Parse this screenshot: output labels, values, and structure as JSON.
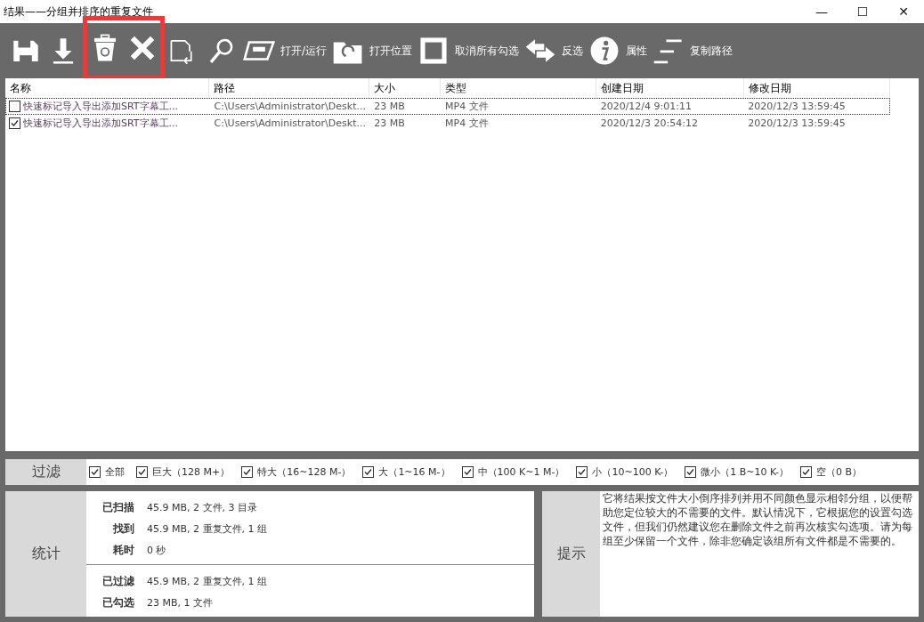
{
  "window": {
    "title": "结果——分组并排序的重复文件",
    "controls": [
      "—",
      "☐",
      "✕"
    ]
  },
  "toolbar": [
    {
      "highlighted": false,
      "items": [
        {
          "kind": "icon"
        },
        {
          "kind": "icon"
        }
      ]
    },
    {
      "highlighted": true,
      "items": [
        {
          "kind": "icon"
        },
        {
          "kind": "icon"
        }
      ]
    },
    {
      "highlighted": false,
      "items": [
        {
          "kind": "icon"
        },
        {
          "kind": "icon"
        },
        {
          "kind": "labeled",
          "label": "打开/运行"
        },
        {
          "kind": "labeled",
          "label": "打开位置"
        },
        {
          "kind": "labeled",
          "label": "取消所有勾选"
        },
        {
          "kind": "labeled",
          "label": "反选"
        },
        {
          "kind": "labeled",
          "label": "属性"
        },
        {
          "kind": "labeled",
          "label": "复制路径"
        }
      ]
    }
  ],
  "table": {
    "columns": [
      "名称",
      "路径",
      "大小",
      "类型",
      "创建日期",
      "修改日期"
    ],
    "rows": [
      {
        "checked": false,
        "focused": true,
        "cells": [
          "快速标记导入导出添加SRT字幕工...",
          "C:\\Users\\Administrator\\Deskt...",
          "23 MB",
          "MP4 文件",
          "2020/12/4 9:01:11",
          "2020/12/3 13:59:45"
        ]
      },
      {
        "checked": true,
        "focused": false,
        "cells": [
          "快速标记导入导出添加SRT字幕工...",
          "C:\\Users\\Administrator\\Deskt...",
          "23 MB",
          "MP4 文件",
          "2020/12/3 20:54:12",
          "2020/12/3 13:59:45"
        ]
      }
    ]
  },
  "filter": {
    "label": "过滤",
    "options": [
      {
        "label": "全部",
        "checked": true
      },
      {
        "label": "巨大（128 M+）",
        "checked": true
      },
      {
        "label": "特大（16~128 M-）",
        "checked": true
      },
      {
        "label": "大（1~16 M-）",
        "checked": true
      },
      {
        "label": "中（100 K~1 M-）",
        "checked": true
      },
      {
        "label": "小（10~100 K-）",
        "checked": true
      },
      {
        "label": "微小（1 B~10 K-）",
        "checked": true
      },
      {
        "label": "空（0 B）",
        "checked": true
      }
    ]
  },
  "stats": {
    "label": "统计",
    "groups": [
      [
        {
          "name": "已扫描",
          "value": "45.9 MB, 2 文件, 3 目录"
        },
        {
          "name": "找到",
          "value": "45.9 MB, 2 重复文件, 1 组"
        },
        {
          "name": "耗时",
          "value": "0 秒"
        }
      ],
      [
        {
          "name": "已过滤",
          "value": "45.9 MB, 2 重复文件, 1 组"
        },
        {
          "name": "已勾选",
          "value": "23 MB, 1 文件"
        }
      ]
    ]
  },
  "hint": {
    "label": "提示",
    "text": "它将结果按文件大小倒序排列并用不同颜色显示相邻分组，以便帮助您定位较大的不需要的文件。默认情况下，它根据您的设置勾选文件，但我们仍然建议您在删除文件之前再次核实勾选项。请为每组至少保留一个文件，除非您确定该组所有文件都是不需要的。"
  }
}
